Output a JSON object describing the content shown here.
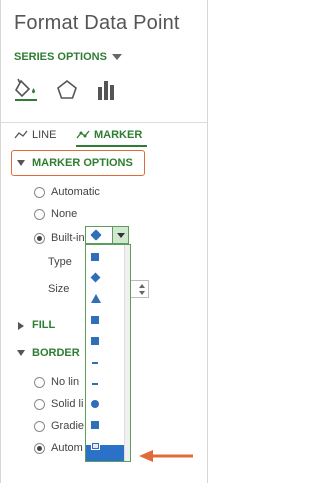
{
  "pane": {
    "title": "Format Data Point",
    "series_options_label": "SERIES OPTIONS",
    "icons": [
      "fill-line-icon",
      "effects-pentagon-icon",
      "series-options-bars-icon"
    ]
  },
  "subtabs": {
    "line_label": "LINE",
    "marker_label": "MARKER"
  },
  "marker_options": {
    "header": "MARKER OPTIONS",
    "options": [
      "Automatic",
      "None",
      "Built-in"
    ],
    "selected": "Built-in",
    "type_label": "Type",
    "size_label": "Size"
  },
  "fill": {
    "header": "FILL"
  },
  "border": {
    "header": "BORDER",
    "options": [
      "No lin",
      "Solid li",
      "Gradie",
      "Autom"
    ],
    "selected": "Autom"
  },
  "type_dropdown": {
    "items": [
      "square",
      "diamond",
      "triangle",
      "square",
      "square",
      "dash",
      "dash",
      "circle",
      "square",
      "picture"
    ],
    "selected_index": 9
  },
  "colors": {
    "accent": "#2e7d32",
    "marker": "#2f6fb7",
    "highlight": "#e06a3a",
    "selection": "#2b71c8"
  }
}
